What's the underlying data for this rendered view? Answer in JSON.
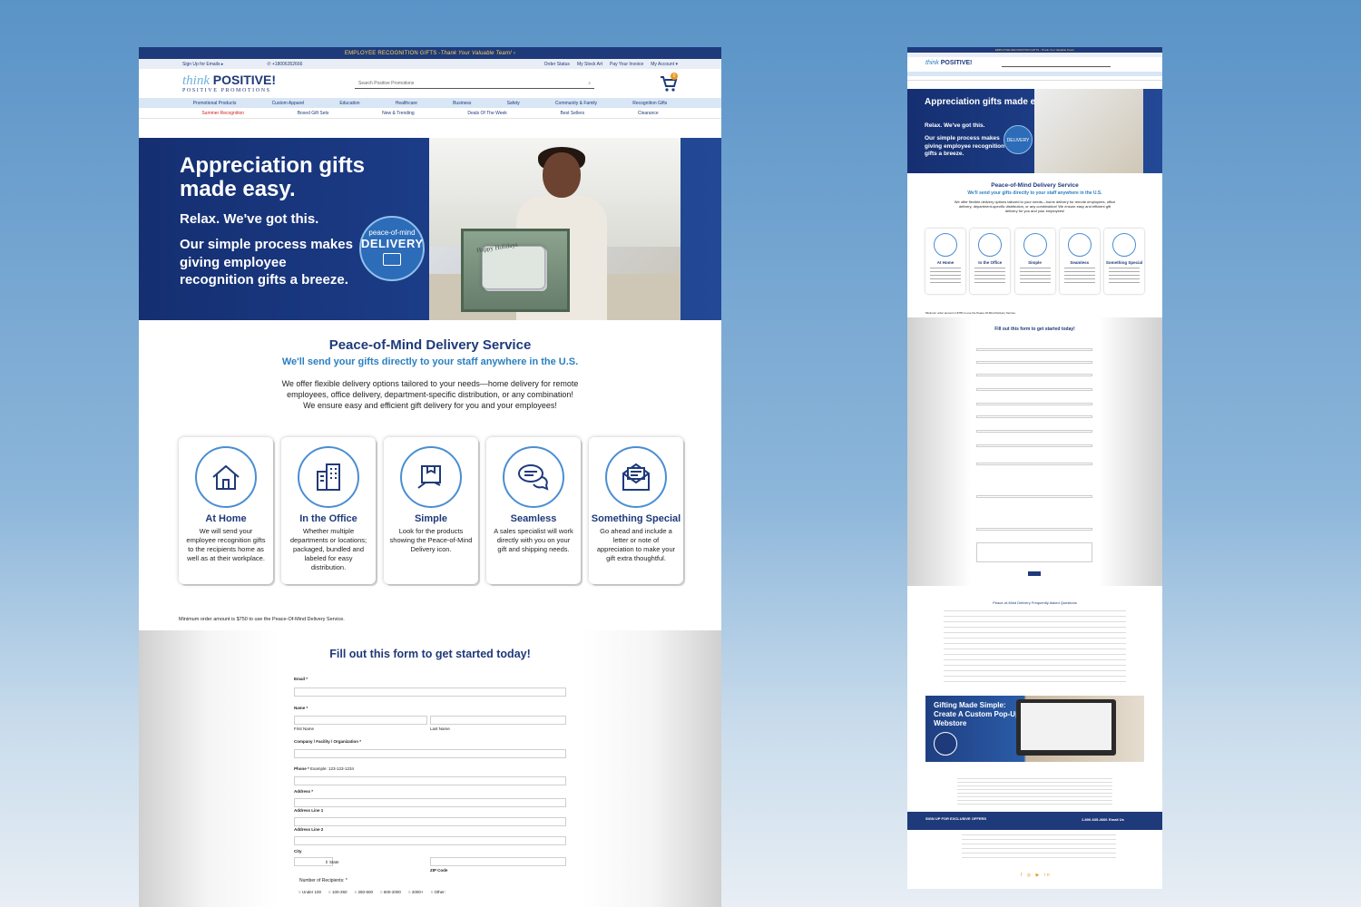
{
  "promo_bar": {
    "text": "EMPLOYEE RECOGNITION GIFTS - ",
    "highlight": "Thank Your Valuable Team!",
    "arrow": "›"
  },
  "utility": {
    "signup": "Sign Up for Emails ▸",
    "phone": "✆ +18006352666",
    "order_status": "Order Status",
    "stock_art": "My Stock Art",
    "invoice": "Pay Your Invoice",
    "account": "My Account ▾"
  },
  "logo": {
    "think": "think",
    "positive": "POSITIVE!",
    "sub": "POSITIVE PROMOTIONS"
  },
  "search": {
    "placeholder": "Search Positive Promotions"
  },
  "cart": {
    "count": "0"
  },
  "nav_primary": [
    "Promotional Products",
    "Custom Apparel",
    "Education",
    "Healthcare",
    "Business",
    "Safety",
    "Community & Family",
    "Recognition Gifts"
  ],
  "nav_secondary": [
    "Summer Recognition",
    "Boxed Gift Sets",
    "New & Trending",
    "Deals Of The Week",
    "Best Sellers",
    "Clearance"
  ],
  "hero": {
    "title_line1": "Appreciation gifts",
    "title_line2": "made easy.",
    "relax": "Relax. We've got this.",
    "process": "Our simple process makes giving employee recognition gifts a breeze.",
    "seal_top": "peace-of-mind",
    "seal_main": "DELIVERY",
    "box_label": "Happy Holidays"
  },
  "pom": {
    "title": "Peace-of-Mind Delivery Service",
    "subtitle": "We'll send your gifts directly to your staff anywhere in the U.S.",
    "body_line1": "We offer flexible delivery options tailored to your needs—home delivery for remote",
    "body_line2": "employees, office delivery, department-specific distribution, or any combination!",
    "body_line3": "We ensure easy and efficient gift delivery for you and your employees!"
  },
  "features": [
    {
      "icon": "house-icon",
      "title": "At Home",
      "desc": "We will send your employee recognition gifts to the recipients home as well as at their workplace."
    },
    {
      "icon": "office-building-icon",
      "title": "In the Office",
      "desc": "Whether multiple departments or locations; packaged, bundled and labeled for easy distribution."
    },
    {
      "icon": "box-hand-icon",
      "title": "Simple",
      "desc": "Look for the products showing the Peace-of-Mind Delivery icon."
    },
    {
      "icon": "chat-bubbles-icon",
      "title": "Seamless",
      "desc": "A sales specialist will work directly with you on your gift and shipping needs."
    },
    {
      "icon": "envelope-icon",
      "title": "Something Special",
      "desc": "Go ahead and include a letter or note of appreciation to make your gift extra thoughtful."
    }
  ],
  "min_order": "Minimum order amount is $750 to use the Peace-Of-Mind Delivery Service.",
  "form": {
    "title": "Fill out this form to get started today!",
    "email": "Email *",
    "name": "Name *",
    "first": "First Name",
    "last": "Last Name",
    "company": "Company / Facility / Organization *",
    "phone": "Phone *",
    "phone_example": "Example: 123-123-1234",
    "address": "Address *",
    "address1": "Address Line 1",
    "address2": "Address Line 2",
    "city": "City",
    "state": "State",
    "zip": "ZIP Code",
    "recipients": "Number of Recipients: *",
    "recipient_options": [
      "Under 100",
      "100-250",
      "250-500",
      "500-2000",
      "2000+",
      "Other:"
    ]
  },
  "side": {
    "hero_title": "Appreciation gifts made easy.",
    "hero_relax": "Relax. We've got this.",
    "hero_process": "Our simple process makes giving employee recognition gifts a breeze.",
    "seal": "DELIVERY",
    "pom_title": "Peace-of-Mind Delivery Service",
    "pom_sub": "We'll send your gifts directly to your staff anywhere in the U.S.",
    "pom_body": "We offer flexible delivery options tailored to your needs—home delivery for remote employees, office delivery, department-specific distribution, or any combination! We ensure easy and efficient gift delivery for you and your employees!",
    "cards": [
      "At Home",
      "In the Office",
      "Simple",
      "Seamless",
      "Something Special"
    ],
    "min_order": "Minimum order amount is $750 to use the Peace-Of-Mind Delivery Service.",
    "form_title": "Fill out this form to get started today!",
    "faq_title": "Peace-of-Mind Delivery Frequently Asked Questions",
    "popup_title": "Gifting Made Simple: Create A Custom Pop-Up Webstore",
    "footer_band": "SIGN UP FOR EXCLUSIVE OFFERS",
    "footer_phone": "1-800-635-2666",
    "footer_email": "Email Us",
    "social": "f ◎ ▶ in"
  },
  "colors": {
    "navy": "#1f3a7a",
    "accent_blue": "#2b7fc0",
    "sale_red": "#d0242a",
    "promo_yellow": "#f4d35e"
  }
}
